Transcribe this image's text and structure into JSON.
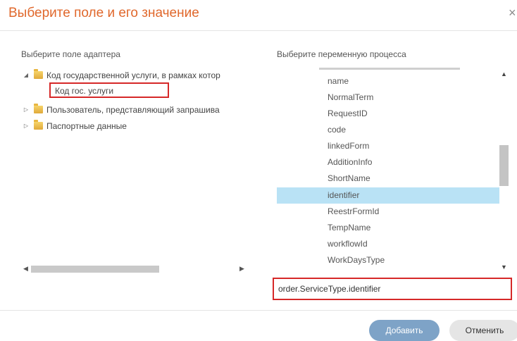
{
  "dialog": {
    "title": "Выберите поле и его значение",
    "close_glyph": "×"
  },
  "left_panel": {
    "label": "Выберите поле адаптера",
    "tree": [
      {
        "label": "Код государственной услуги, в рамках котор",
        "expanded": true,
        "icon": "folder-icon"
      },
      {
        "label": "Пользователь, представляющий запрашива",
        "expanded": false,
        "icon": "folder-icon"
      },
      {
        "label": "Паспортные данные",
        "expanded": false,
        "icon": "folder-icon"
      }
    ],
    "selected_child": "Код гос. услуги"
  },
  "right_panel": {
    "label": "Выберите переменную процесса",
    "items": [
      "name",
      "NormalTerm",
      "RequestID",
      "code",
      "linkedForm",
      "AdditionInfo",
      "ShortName",
      "identifier",
      "ReestrFormId",
      "TempName",
      "workflowId",
      "WorkDaysType"
    ],
    "selected_item": "identifier"
  },
  "value_input": {
    "value": "order.ServiceType.identifier"
  },
  "buttons": {
    "add": "Добавить",
    "cancel": "Отменить"
  },
  "colors": {
    "title": "#e0682c",
    "selection": "#b9e2f5",
    "highlight_border": "#d62828",
    "add_button": "#7ea3c7"
  }
}
